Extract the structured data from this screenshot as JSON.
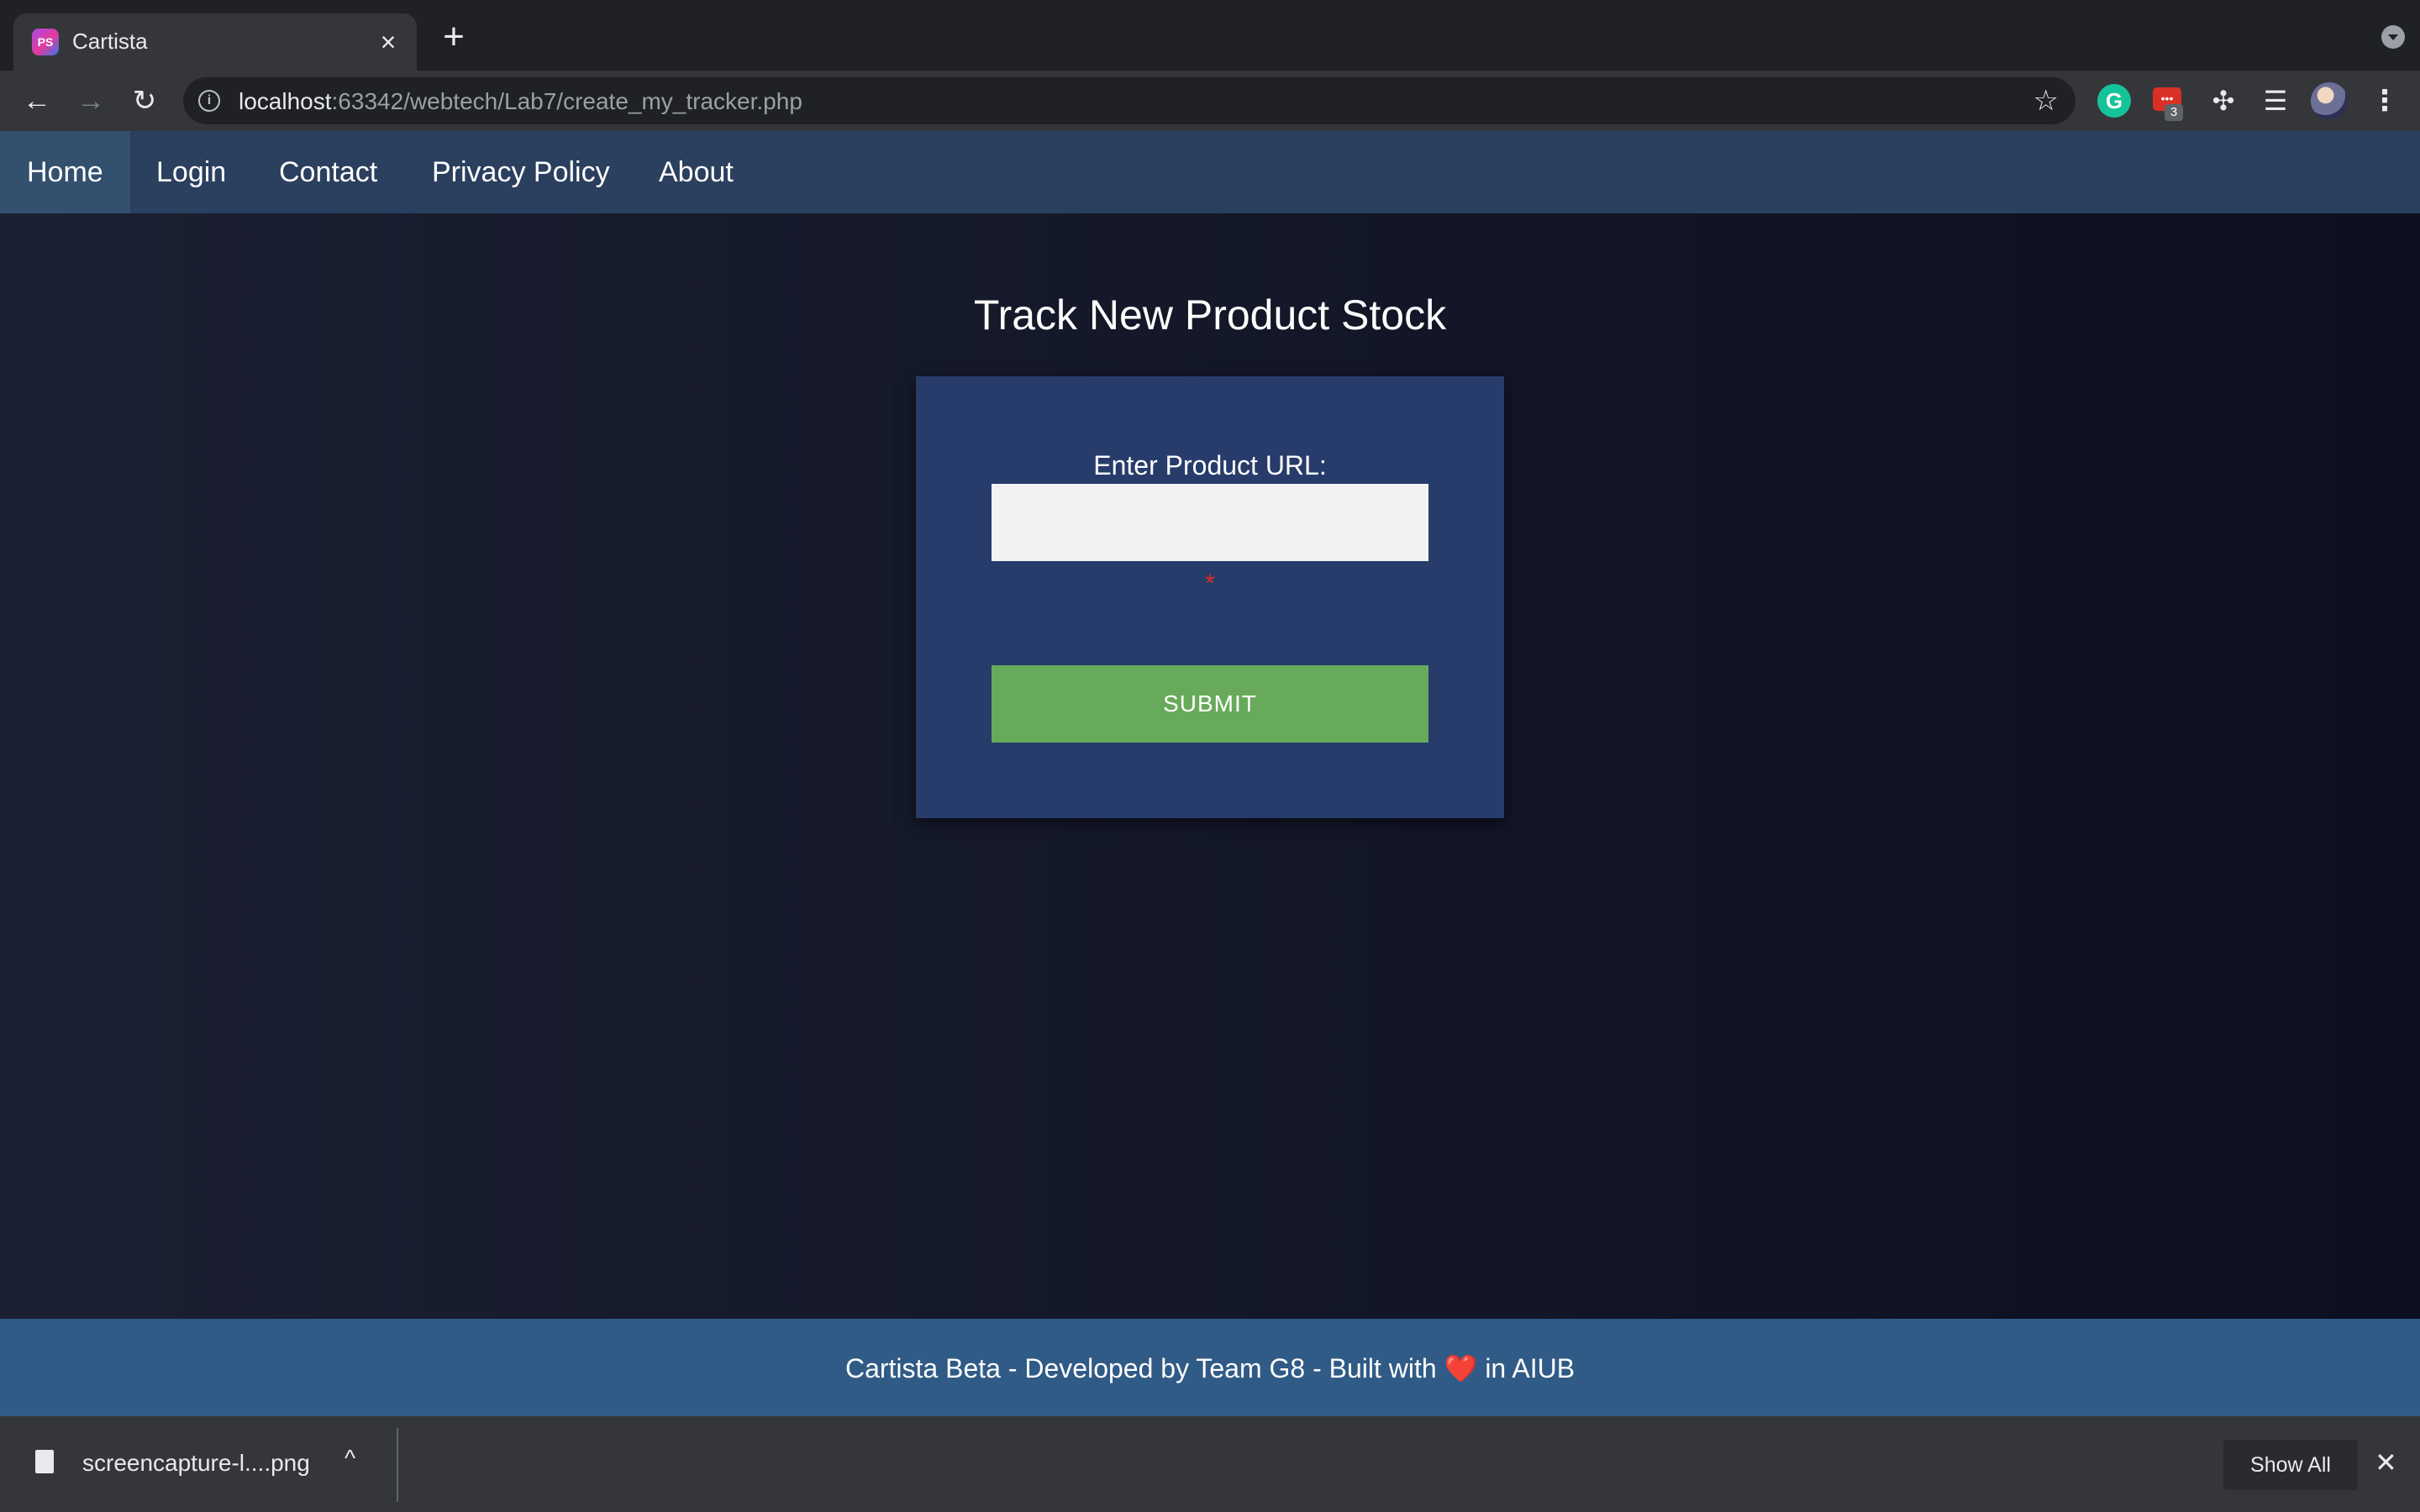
{
  "browser": {
    "tab_title": "Cartista",
    "favicon_text": "PS",
    "url_host": "localhost",
    "url_rest": ":63342/webtech/Lab7/create_my_tracker.php",
    "extension_badge": "3"
  },
  "navbar": {
    "items": [
      {
        "label": "Home",
        "active": true
      },
      {
        "label": "Login"
      },
      {
        "label": "Contact"
      },
      {
        "label": "Privacy Policy"
      },
      {
        "label": "About"
      }
    ]
  },
  "page": {
    "title": "Track New Product Stock",
    "form": {
      "url_label": "Enter Product URL:",
      "url_value": "",
      "required_mark": "*",
      "submit_label": "SUBMIT"
    }
  },
  "footer": {
    "text_before": "Cartista Beta - Developed by Team G8 - Built with",
    "heart": "❤️",
    "text_after": " in AIUB"
  },
  "download_shelf": {
    "file_name": "screencapture-l....png",
    "show_all_label": "Show All"
  },
  "colors": {
    "navbar": "#2b3f5e",
    "form_card": "#273c6a",
    "submit": "#68aa5c",
    "footer": "#305b86"
  }
}
